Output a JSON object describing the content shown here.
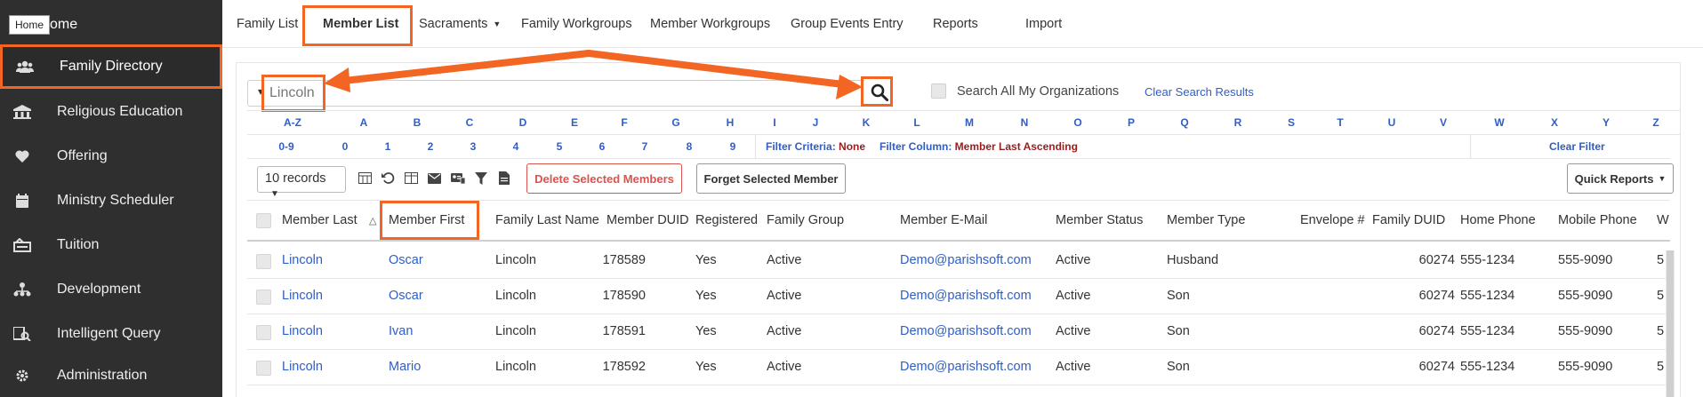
{
  "sidebar": {
    "home_tooltip": "Home",
    "home_label": "ome",
    "items": [
      {
        "label": "Family Directory",
        "icon": "users-icon"
      },
      {
        "label": "Religious Education",
        "icon": "school-icon"
      },
      {
        "label": "Offering",
        "icon": "heart-icon"
      },
      {
        "label": "Ministry Scheduler",
        "icon": "calendar-icon"
      },
      {
        "label": "Tuition",
        "icon": "tuition-icon"
      },
      {
        "label": "Development",
        "icon": "sitemap-icon"
      },
      {
        "label": "Intelligent Query",
        "icon": "query-icon"
      },
      {
        "label": "Administration",
        "icon": "gear-icon"
      }
    ]
  },
  "topnav": {
    "tabs": [
      {
        "label": "Family List"
      },
      {
        "label": "Member List"
      },
      {
        "label": "Sacraments"
      },
      {
        "label": "Family Workgroups"
      },
      {
        "label": "Member Workgroups"
      },
      {
        "label": "Group Events Entry"
      },
      {
        "label": "Reports"
      },
      {
        "label": "Import"
      }
    ]
  },
  "search": {
    "value": "Lincoln",
    "search_all_label": "Search All My Organizations",
    "clear_label": "Clear Search Results"
  },
  "alphabet": [
    "A-Z",
    "A",
    "B",
    "C",
    "D",
    "E",
    "F",
    "G",
    "H",
    "I",
    "J",
    "K",
    "L",
    "M",
    "N",
    "O",
    "P",
    "Q",
    "R",
    "S",
    "T",
    "U",
    "V",
    "W",
    "X",
    "Y",
    "Z"
  ],
  "digits": [
    "0-9",
    "0",
    "1",
    "2",
    "3",
    "4",
    "5",
    "6",
    "7",
    "8",
    "9"
  ],
  "filter": {
    "criteria_key": "Filter Criteria:",
    "criteria_val": "None",
    "column_key": "Filter Column:",
    "column_val": "Member Last Ascending",
    "clear_label": "Clear Filter"
  },
  "toolbar": {
    "records": "10 records",
    "delete_label": "Delete Selected Members",
    "forget_label": "Forget Selected Member",
    "quick_reports_label": "Quick Reports"
  },
  "table": {
    "headers": [
      "Member Last",
      "Member First",
      "Family Last Name",
      "Member DUID",
      "Registered",
      "Family Group",
      "Member E-Mail",
      "Member Status",
      "Member Type",
      "Envelope #",
      "Family DUID",
      "Home Phone",
      "Mobile Phone",
      "W"
    ],
    "rows": [
      {
        "last": "Lincoln",
        "first": "Oscar",
        "family": "Lincoln",
        "duid": "178589",
        "registered": "Yes",
        "group": "Active",
        "email": "Demo@parishsoft.com",
        "status": "Active",
        "type": "Husband",
        "envelope": "",
        "fduid": "60274",
        "home": "555-1234",
        "mobile": "555-9090",
        "w": "5"
      },
      {
        "last": "Lincoln",
        "first": "Oscar",
        "family": "Lincoln",
        "duid": "178590",
        "registered": "Yes",
        "group": "Active",
        "email": "Demo@parishsoft.com",
        "status": "Active",
        "type": "Son",
        "envelope": "",
        "fduid": "60274",
        "home": "555-1234",
        "mobile": "555-9090",
        "w": "5"
      },
      {
        "last": "Lincoln",
        "first": "Ivan",
        "family": "Lincoln",
        "duid": "178591",
        "registered": "Yes",
        "group": "Active",
        "email": "Demo@parishsoft.com",
        "status": "Active",
        "type": "Son",
        "envelope": "",
        "fduid": "60274",
        "home": "555-1234",
        "mobile": "555-9090",
        "w": "5"
      },
      {
        "last": "Lincoln",
        "first": "Mario",
        "family": "Lincoln",
        "duid": "178592",
        "registered": "Yes",
        "group": "Active",
        "email": "Demo@parishsoft.com",
        "status": "Active",
        "type": "Son",
        "envelope": "",
        "fduid": "60274",
        "home": "555-1234",
        "mobile": "555-9090",
        "w": "5"
      }
    ]
  },
  "colors": {
    "accent": "#2f5ec4",
    "highlight": "#f26522",
    "sidebar": "#2f2f2f",
    "danger": "#d9534f"
  }
}
